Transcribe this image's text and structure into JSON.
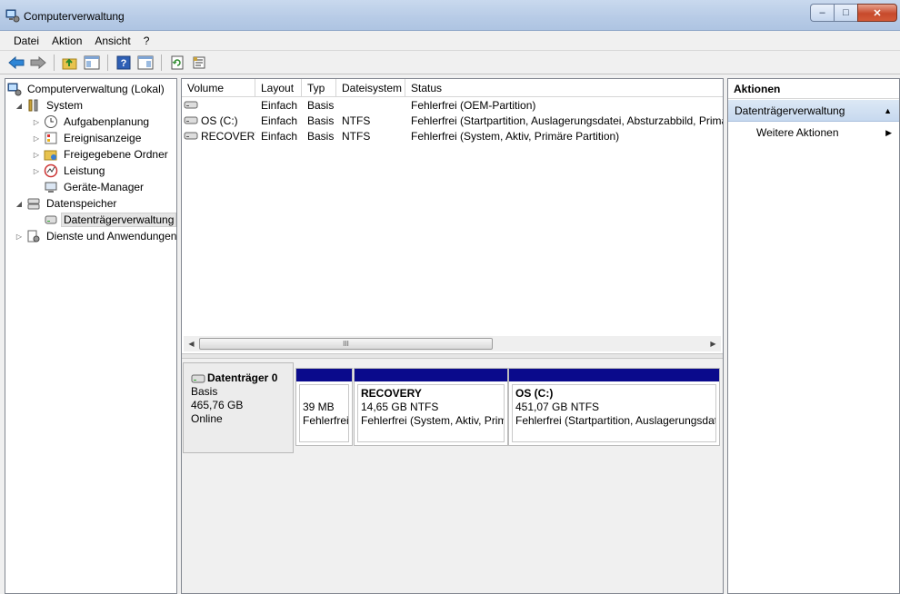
{
  "window": {
    "title": "Computerverwaltung",
    "controls": {
      "minimize": "‒",
      "maximize": "□",
      "close": "✕"
    }
  },
  "menu": [
    "Datei",
    "Aktion",
    "Ansicht",
    "?"
  ],
  "tree": [
    {
      "label": "Computerverwaltung (Lokal)",
      "icon": "computer-management-icon",
      "indent": 0,
      "expander": ""
    },
    {
      "label": "System",
      "icon": "tools-icon",
      "indent": 1,
      "expander": "◢"
    },
    {
      "label": "Aufgabenplanung",
      "icon": "clock-icon",
      "indent": 2,
      "expander": "▷"
    },
    {
      "label": "Ereignisanzeige",
      "icon": "event-viewer-icon",
      "indent": 2,
      "expander": "▷"
    },
    {
      "label": "Freigegebene Ordner",
      "icon": "shared-folder-icon",
      "indent": 2,
      "expander": "▷"
    },
    {
      "label": "Leistung",
      "icon": "performance-icon",
      "indent": 2,
      "expander": "▷"
    },
    {
      "label": "Geräte-Manager",
      "icon": "device-manager-icon",
      "indent": 2,
      "expander": ""
    },
    {
      "label": "Datenspeicher",
      "icon": "storage-icon",
      "indent": 1,
      "expander": "◢"
    },
    {
      "label": "Datenträgerverwaltung",
      "icon": "disk-management-icon",
      "indent": 2,
      "expander": "",
      "selected": true
    },
    {
      "label": "Dienste und Anwendungen",
      "icon": "services-icon",
      "indent": 1,
      "expander": "▷"
    }
  ],
  "columns": [
    "Volume",
    "Layout",
    "Typ",
    "Dateisystem",
    "Status"
  ],
  "volumes": [
    {
      "volume": "",
      "layout": "Einfach",
      "typ": "Basis",
      "dateisystem": "",
      "status": "Fehlerfrei (OEM-Partition)"
    },
    {
      "volume": "OS (C:)",
      "layout": "Einfach",
      "typ": "Basis",
      "dateisystem": "NTFS",
      "status": "Fehlerfrei (Startpartition, Auslagerungsdatei, Absturzabbild, Primä"
    },
    {
      "volume": "RECOVERY",
      "layout": "Einfach",
      "typ": "Basis",
      "dateisystem": "NTFS",
      "status": "Fehlerfrei (System, Aktiv, Primäre Partition)"
    }
  ],
  "scrollbar": {
    "left": "◀",
    "right": "▶",
    "grip": "III"
  },
  "disk": {
    "name": "Datenträger 0",
    "type": "Basis",
    "size": "465,76 GB",
    "state": "Online",
    "partitions": [
      {
        "name": "",
        "size": "39 MB",
        "status": "Fehlerfrei"
      },
      {
        "name": "RECOVERY",
        "size": "14,65 GB NTFS",
        "status": "Fehlerfrei (System, Aktiv, Prim"
      },
      {
        "name": "OS  (C:)",
        "size": "451,07 GB NTFS",
        "status": "Fehlerfrei (Startpartition, Auslagerungsdat"
      }
    ]
  },
  "actions": {
    "header": "Aktionen",
    "section": "Datenträgerverwaltung",
    "section_caret": "▲",
    "item": "Weitere Aktionen",
    "item_caret": "▶"
  }
}
